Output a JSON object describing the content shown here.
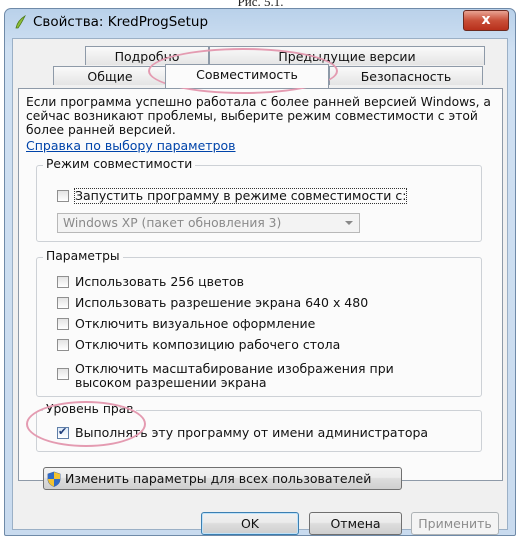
{
  "caption": "Рис. 5.1.",
  "window": {
    "title": "Свойства: KredProgSetup",
    "close_symbol": "x"
  },
  "tabs": {
    "back_row": [
      "Подробно",
      "Предыдущие версии"
    ],
    "front_row": [
      "Общие",
      "Совместимость",
      "Безопасность"
    ],
    "active": "Совместимость"
  },
  "intro": {
    "text": "Если программа успешно работала с более ранней версией Windows, а сейчас возникают проблемы, выберите режим совместимости с этой более ранней версией.",
    "help_link": "Справка по выбору параметров"
  },
  "compat_mode": {
    "title": "Режим совместимости",
    "checkbox_label": "Запустить программу в режиме совместимости с:",
    "checked": false,
    "dropdown_value": "Windows XP (пакет обновления 3)"
  },
  "settings": {
    "title": "Параметры",
    "options": [
      {
        "label": "Использовать 256 цветов",
        "checked": false
      },
      {
        "label": "Использовать разрешение экрана 640 x 480",
        "checked": false
      },
      {
        "label": "Отключить визуальное оформление",
        "checked": false
      },
      {
        "label": "Отключить композицию рабочего стола",
        "checked": false
      },
      {
        "label_line1": "Отключить масштабирование изображения при",
        "label_line2": "высоком разрешении экрана",
        "checked": false
      }
    ]
  },
  "privilege": {
    "title": "Уровень прав",
    "checkbox_label": "Выполнять эту программу от имени администратора",
    "checked": true
  },
  "all_users_button": "Изменить параметры для всех пользователей",
  "buttons": {
    "ok": "OK",
    "cancel": "Отмена",
    "apply": "Применить"
  },
  "colors": {
    "highlight": "#e49bb1",
    "link": "#0044aa",
    "close": "#c94f38"
  }
}
